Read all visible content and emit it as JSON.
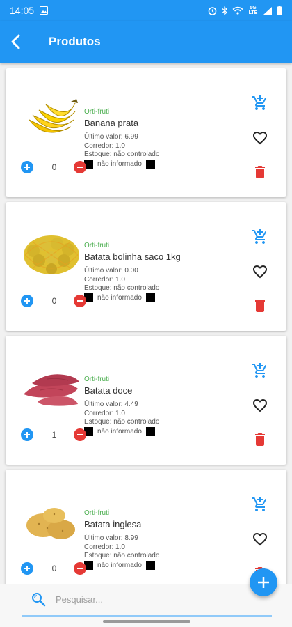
{
  "status_bar": {
    "time": "14:05",
    "network": "5G LTE"
  },
  "app_bar": {
    "title": "Produtos"
  },
  "products": [
    {
      "category": "Orti-fruti",
      "name": "Banana prata",
      "last_value": "Último valor: 6.99",
      "corridor": "Corredor: 1.0",
      "stock": "Estoque: não controlado",
      "tag": "não informado",
      "quantity": "0",
      "image": "banana"
    },
    {
      "category": "Orti-fruti",
      "name": "Batata bolinha saco 1kg",
      "last_value": "Último valor: 0.00",
      "corridor": "Corredor: 1.0",
      "stock": "Estoque: não controlado",
      "tag": "não informado",
      "quantity": "0",
      "image": "potato-bag"
    },
    {
      "category": "Orti-fruti",
      "name": "Batata doce",
      "last_value": "Último valor: 4.49",
      "corridor": "Corredor: 1.0",
      "stock": "Estoque: não controlado",
      "tag": "não informado",
      "quantity": "1",
      "image": "sweet-potato"
    },
    {
      "category": "Orti-fruti",
      "name": "Batata inglesa",
      "last_value": "Último valor: 8.99",
      "corridor": "Corredor: 1.0",
      "stock": "Estoque: não controlado",
      "tag": "não informado",
      "quantity": "0",
      "image": "potato"
    }
  ],
  "search": {
    "placeholder": "Pesquisar..."
  },
  "colors": {
    "primary": "#2196f3",
    "category": "#4caf50",
    "delete": "#e53935"
  },
  "icons": {
    "add_to_cart": "add-shopping-cart-icon",
    "favorite": "heart-outline-icon",
    "delete": "trash-icon",
    "increment": "plus-circle-icon",
    "decrement": "minus-circle-icon",
    "fab": "plus-icon",
    "search": "search-refresh-icon",
    "back": "chevron-left-icon"
  }
}
